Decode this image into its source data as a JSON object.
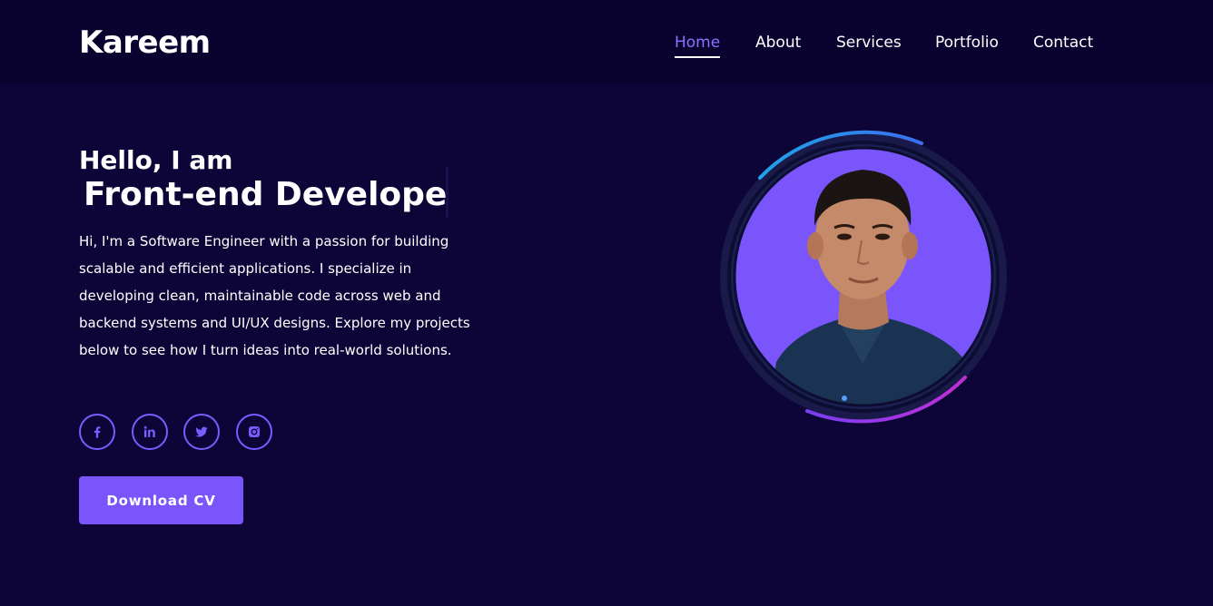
{
  "header": {
    "logo": "Kareem",
    "nav": [
      {
        "label": "Home",
        "active": true
      },
      {
        "label": "About",
        "active": false
      },
      {
        "label": "Services",
        "active": false
      },
      {
        "label": "Portfolio",
        "active": false
      },
      {
        "label": "Contact",
        "active": false
      }
    ]
  },
  "hero": {
    "greeting": "Hello, I am",
    "role": "Front-end Developer",
    "bio": "Hi, I'm a Software Engineer with a passion for building scalable and efficient applications. I specialize in developing clean, maintainable code across web and backend systems and UI/UX designs. Explore my projects below to see how I turn ideas into real-world solutions.",
    "socials": [
      {
        "icon": "facebook-icon"
      },
      {
        "icon": "linkedin-icon"
      },
      {
        "icon": "twitter-icon"
      },
      {
        "icon": "instagram-icon"
      }
    ],
    "cta_label": "Download CV"
  },
  "colors": {
    "background": "#0d0438",
    "header_background": "#0a0330",
    "accent": "#7a55fb",
    "active_nav": "#8d73ff",
    "ring_blue": "#2d8cf0",
    "ring_purple": "#b02fd8",
    "portrait_bg": "#7a55fb"
  }
}
